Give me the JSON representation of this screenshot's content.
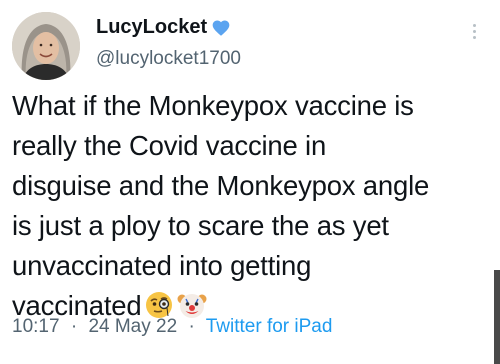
{
  "tweet": {
    "display_name": "LucyLocket",
    "verified_icon": "verified-badge-icon",
    "handle": "@lucylocket1700",
    "text_lines": [
      "What if the Monkeypox vaccine is",
      "really the Covid vaccine in",
      "disguise and the Monkeypox angle",
      "is just a ploy to scare the as yet",
      "unvaccinated into getting",
      "vaccinated"
    ],
    "emojis": [
      "face-with-monocle",
      "clown-face"
    ],
    "time": "10:17",
    "date": "24 May 22",
    "separator": "·",
    "source": "Twitter for iPad"
  },
  "colors": {
    "text": "#0f1419",
    "secondary": "#536471",
    "link": "#1d9bf0"
  }
}
